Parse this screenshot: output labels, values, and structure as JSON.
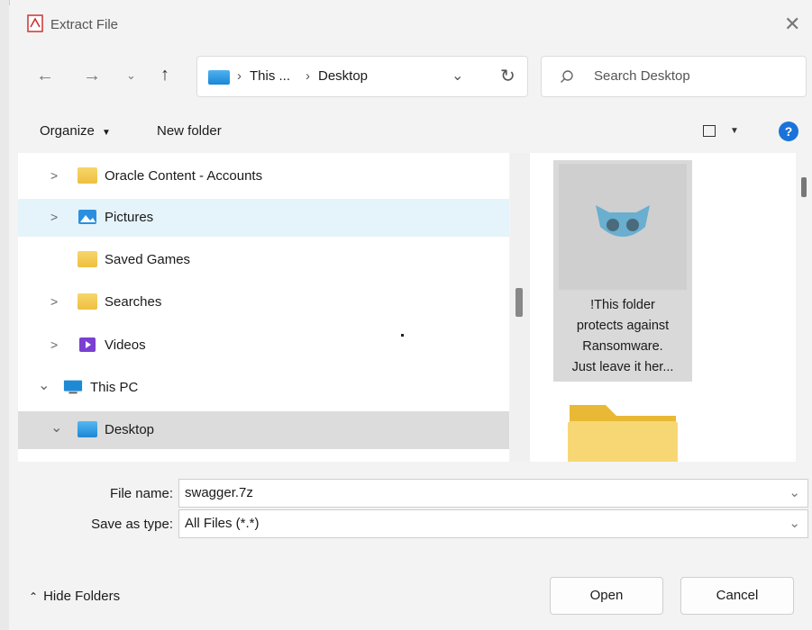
{
  "title": "Extract File",
  "nav": {
    "back_icon": "arrow-left-icon",
    "forward_icon": "arrow-right-icon",
    "recent_icon": "chevron-down-icon",
    "up_icon": "arrow-up-icon",
    "refresh_icon": "refresh-icon"
  },
  "address": {
    "crumb1": "This ...",
    "crumb2": "Desktop",
    "sep": "›"
  },
  "search": {
    "placeholder": "Search Desktop"
  },
  "toolbar": {
    "organize": "Organize",
    "new_folder": "New folder",
    "help": "?"
  },
  "tree": [
    {
      "label": "Oracle Content - Accounts",
      "icon": "folder-icon",
      "chevron": ">",
      "state": "normal"
    },
    {
      "label": "Pictures",
      "icon": "pictures-icon",
      "chevron": ">",
      "state": "hover"
    },
    {
      "label": "Saved Games",
      "icon": "folder-icon",
      "chevron": "",
      "state": "normal"
    },
    {
      "label": "Searches",
      "icon": "folder-icon",
      "chevron": ">",
      "state": "normal"
    },
    {
      "label": "Videos",
      "icon": "videos-icon",
      "chevron": ">",
      "state": "normal"
    },
    {
      "label": "This PC",
      "icon": "pc-icon",
      "chevron": "⌄",
      "state": "normal"
    },
    {
      "label": "Desktop",
      "icon": "desktop-icon",
      "chevron": "⌄",
      "state": "selected"
    }
  ],
  "files": {
    "item1": {
      "line1": "!This folder",
      "line2": "protects against",
      "line3": "Ransomware.",
      "line4": "Just leave it her..."
    }
  },
  "form": {
    "file_name_label": "File name:",
    "file_name_value": "swagger.7z",
    "save_type_label": "Save as type:",
    "save_type_value": "All Files (*.*)"
  },
  "footer": {
    "hide_folders": "Hide Folders",
    "open": "Open",
    "cancel": "Cancel"
  },
  "colors": {
    "hover_row": "#e5f3fb",
    "selected_row": "#dcdcdc",
    "help_blue": "#1a73d9",
    "folder_yellow": "#f0c442"
  }
}
